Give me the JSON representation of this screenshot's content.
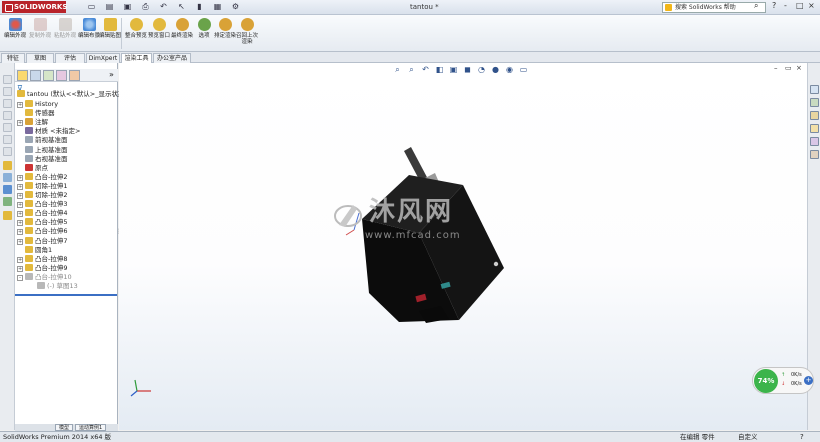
{
  "app": {
    "brand": "SOLIDWORKS",
    "document_title": "tantou *",
    "help_search_placeholder": "搜索 SolidWorks 帮助",
    "window_controls": [
      "?",
      "-",
      "□",
      "×"
    ]
  },
  "quick_access": [
    "new-icon",
    "open-icon",
    "save-icon",
    "print-icon",
    "undo-icon",
    "select-icon",
    "rebuild-icon",
    "file-props-icon",
    "options-icon"
  ],
  "command_manager": [
    {
      "label": "编辑外观",
      "enabled": true,
      "color": "#d8504a"
    },
    {
      "label": "复制外观",
      "enabled": false,
      "color": "#c7a3a0"
    },
    {
      "label": "粘贴外观",
      "enabled": false,
      "color": "#b9b0a8"
    },
    {
      "label": "编辑布景",
      "enabled": true,
      "color": "#4a8bd8"
    },
    {
      "label": "编辑贴图",
      "enabled": true,
      "color": "#e2b93d"
    },
    {
      "label": "整合预览",
      "enabled": true,
      "color": "#e2b93d"
    },
    {
      "label": "预览窗口",
      "enabled": true,
      "color": "#e2b93d"
    },
    {
      "label": "最终渲染",
      "enabled": true,
      "color": "#d9a237"
    },
    {
      "label": "选项",
      "enabled": true,
      "color": "#6aa34a"
    },
    {
      "label": "排定渲染",
      "enabled": true,
      "color": "#d9a237"
    },
    {
      "label": "召回上次渲染",
      "enabled": true,
      "color": "#d9a237"
    }
  ],
  "tabs": [
    "特征",
    "草图",
    "评估",
    "DimXpert",
    "渲染工具",
    "办公室产品"
  ],
  "active_tab": "渲染工具",
  "tree": {
    "root": "tantou (默认<<默认>_显示状态",
    "nodes": [
      {
        "label": "History",
        "expander": "+",
        "color": "#e2b93d"
      },
      {
        "label": "传感器",
        "expander": "",
        "color": "#e2b93d"
      },
      {
        "label": "注解",
        "expander": "+",
        "color": "#d9a237"
      },
      {
        "label": "材质 <未指定>",
        "expander": "",
        "color": "#7a6a9e"
      },
      {
        "label": "前视基准面",
        "expander": "",
        "color": "#9aa6b4"
      },
      {
        "label": "上视基准面",
        "expander": "",
        "color": "#9aa6b4"
      },
      {
        "label": "右视基准面",
        "expander": "",
        "color": "#9aa6b4"
      },
      {
        "label": "原点",
        "expander": "",
        "color": "#cc3333"
      },
      {
        "label": "凸台-拉伸2",
        "expander": "+",
        "color": "#e2b93d"
      },
      {
        "label": "切除-拉伸1",
        "expander": "+",
        "color": "#e2b93d"
      },
      {
        "label": "切除-拉伸2",
        "expander": "+",
        "color": "#e2b93d"
      },
      {
        "label": "凸台-拉伸3",
        "expander": "+",
        "color": "#e2b93d"
      },
      {
        "label": "凸台-拉伸4",
        "expander": "+",
        "color": "#e2b93d"
      },
      {
        "label": "凸台-拉伸5",
        "expander": "+",
        "color": "#e2b93d"
      },
      {
        "label": "凸台-拉伸6",
        "expander": "+",
        "color": "#e2b93d"
      },
      {
        "label": "凸台-拉伸7",
        "expander": "+",
        "color": "#e2b93d"
      },
      {
        "label": "圆角1",
        "expander": "",
        "color": "#e2b93d"
      },
      {
        "label": "凸台-拉伸8",
        "expander": "+",
        "color": "#e2b93d"
      },
      {
        "label": "凸台-拉伸9",
        "expander": "+",
        "color": "#e2b93d"
      },
      {
        "label": "凸台-拉伸10",
        "expander": "-",
        "color": "#b8b8b8"
      },
      {
        "label": "(-) 草图13",
        "expander": "",
        "color": "#b8b8b8"
      }
    ]
  },
  "bottom_tabs": [
    "模型",
    "运动算例1"
  ],
  "status": {
    "left": "SolidWorks Premium 2014 x64 版",
    "edit_mode": "在编辑 零件",
    "custom": "自定义"
  },
  "watermark": {
    "title": "沐风网",
    "url": "www.mfcad.com"
  },
  "net_widget": {
    "percent": "74%",
    "up": "0K/s",
    "down": "0K/s"
  }
}
